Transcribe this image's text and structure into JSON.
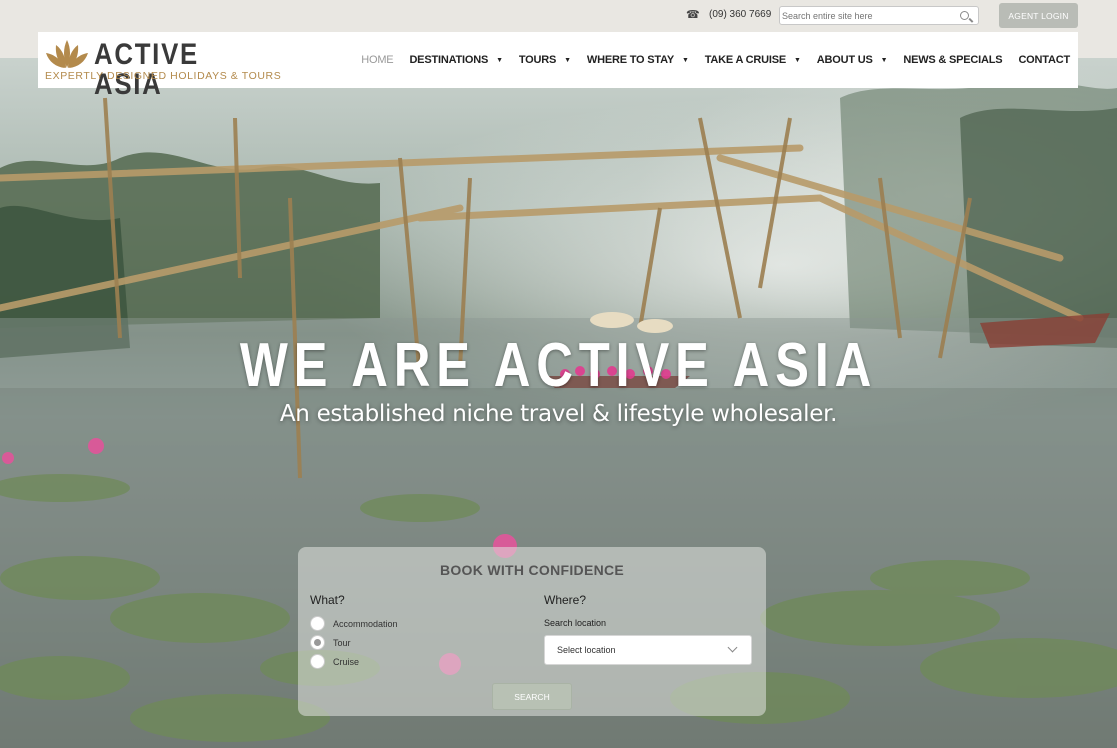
{
  "topbar": {
    "phone_icon": "☎",
    "phone": "(09) 360 7669",
    "search_placeholder": "Search entire site here",
    "agent_login": "AGENT LOGIN"
  },
  "logo": {
    "title": "ACTIVE ASIA",
    "tagline": "EXPERTLY DESIGNED HOLIDAYS & TOURS",
    "icon": "lotus-icon",
    "brand_color": "#b38a4c"
  },
  "nav": {
    "items": [
      {
        "label": "HOME",
        "active": true,
        "dropdown": false
      },
      {
        "label": "DESTINATIONS",
        "active": false,
        "dropdown": true
      },
      {
        "label": "TOURS",
        "active": false,
        "dropdown": true
      },
      {
        "label": "WHERE TO STAY",
        "active": false,
        "dropdown": true
      },
      {
        "label": "TAKE A CRUISE",
        "active": false,
        "dropdown": true
      },
      {
        "label": "ABOUT US",
        "active": false,
        "dropdown": true
      },
      {
        "label": "NEWS & SPECIALS",
        "active": false,
        "dropdown": false
      },
      {
        "label": "CONTACT",
        "active": false,
        "dropdown": false
      }
    ],
    "caret": "▼"
  },
  "hero": {
    "title": "WE ARE ACTIVE ASIA",
    "subtitle": "An established niche travel & lifestyle wholesaler."
  },
  "booking": {
    "title": "BOOK WITH CONFIDENCE",
    "what_label": "What?",
    "where_label": "Where?",
    "options": [
      {
        "label": "Accommodation",
        "checked": false
      },
      {
        "label": "Tour",
        "checked": true
      },
      {
        "label": "Cruise",
        "checked": false
      }
    ],
    "search_location_label": "Search location",
    "select_location": "Select location",
    "search_button": "SEARCH"
  }
}
